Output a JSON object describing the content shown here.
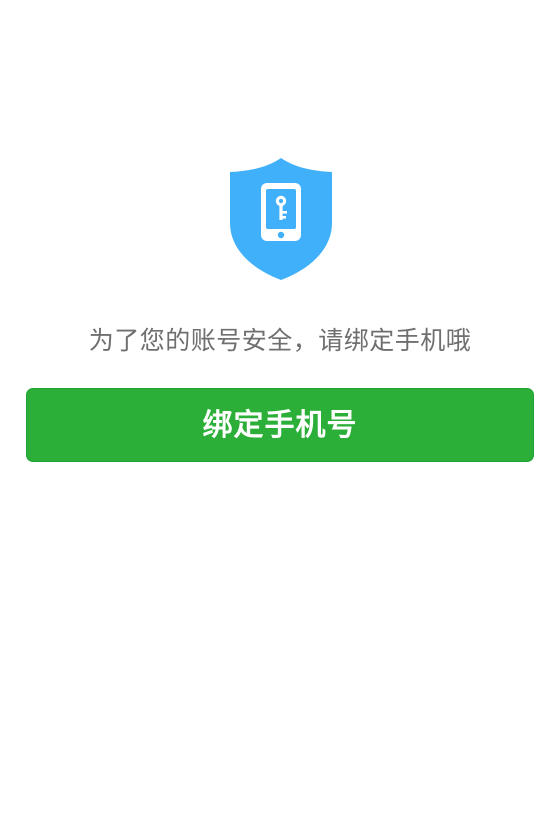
{
  "icon": {
    "name": "shield-phone-key-icon",
    "shield_color": "#40b0fb",
    "inner_color": "#ffffff"
  },
  "message": "为了您的账号安全，请绑定手机哦",
  "bind_button": {
    "label": "绑定手机号",
    "background_color": "#2baf38",
    "text_color": "#ffffff"
  },
  "colors": {
    "page_background": "#ffffff",
    "message_text": "#6f6f6f"
  }
}
